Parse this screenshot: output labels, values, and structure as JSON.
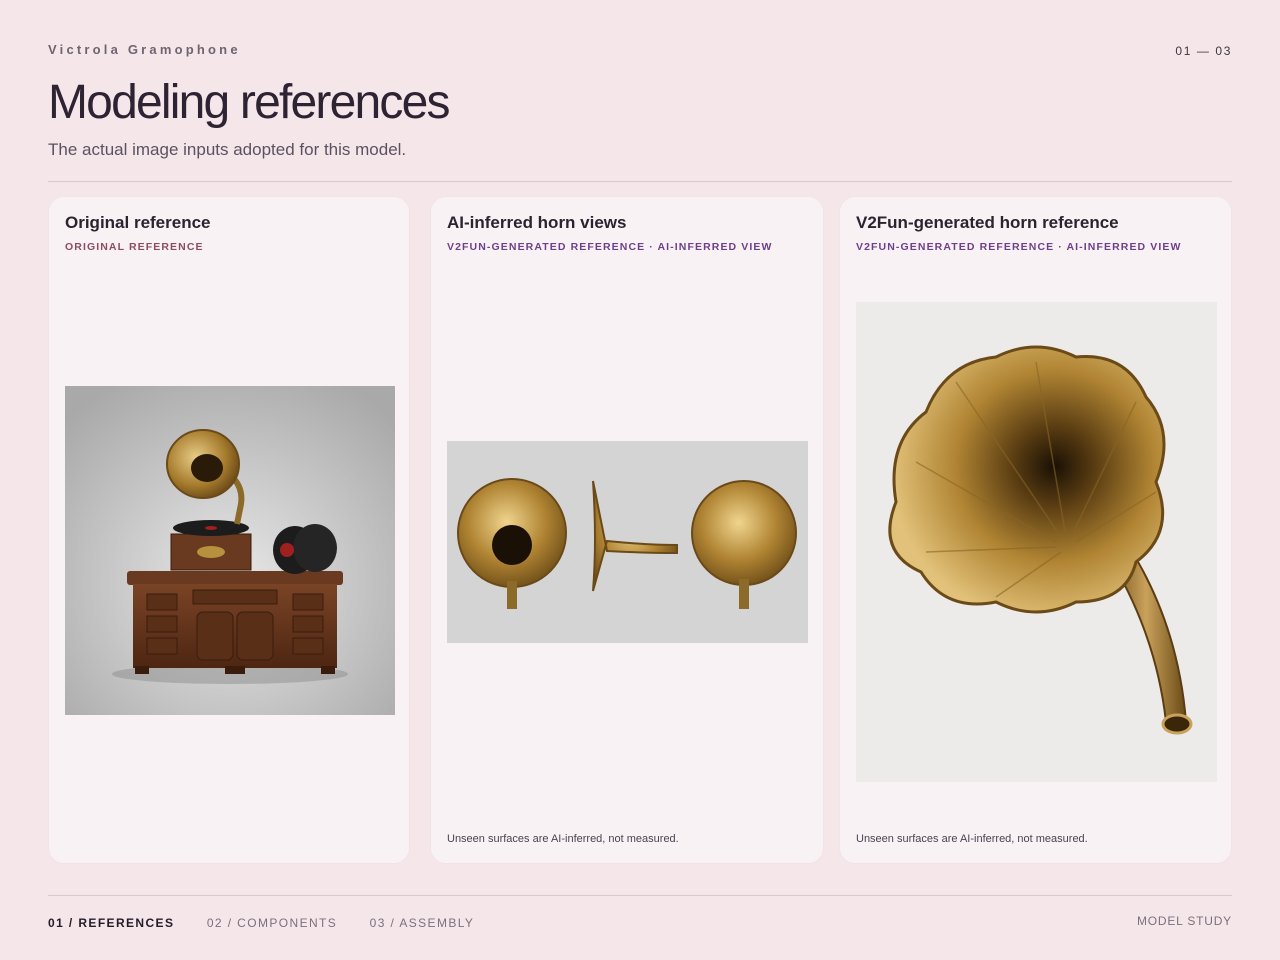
{
  "header": {
    "eyebrow": "Victrola Gramophone",
    "counter": "01 — 03",
    "title": "Modeling references",
    "subtitle": "The actual image inputs adopted for this model."
  },
  "cards": [
    {
      "title": "Original reference",
      "tag": "ORIGINAL REFERENCE",
      "note": ""
    },
    {
      "title": "AI-inferred horn views",
      "tag": "V2FUN-GENERATED REFERENCE · AI-INFERRED VIEW",
      "note": "Unseen surfaces are AI-inferred, not measured."
    },
    {
      "title": "V2Fun-generated horn reference",
      "tag": "V2FUN-GENERATED REFERENCE · AI-INFERRED VIEW",
      "note": "Unseen surfaces are AI-inferred, not measured."
    }
  ],
  "footer": {
    "nav": [
      {
        "label": "01 / REFERENCES",
        "active": true
      },
      {
        "label": "02 / COMPONENTS",
        "active": false
      },
      {
        "label": "03 / ASSEMBLY",
        "active": false
      }
    ],
    "study": "MODEL STUDY"
  },
  "colors": {
    "background": "#f5e6ea",
    "card": "#f9f2f4",
    "tag_original": "#8c4d63",
    "tag_generated": "#6e3f8d",
    "brass": "#b8913f"
  }
}
